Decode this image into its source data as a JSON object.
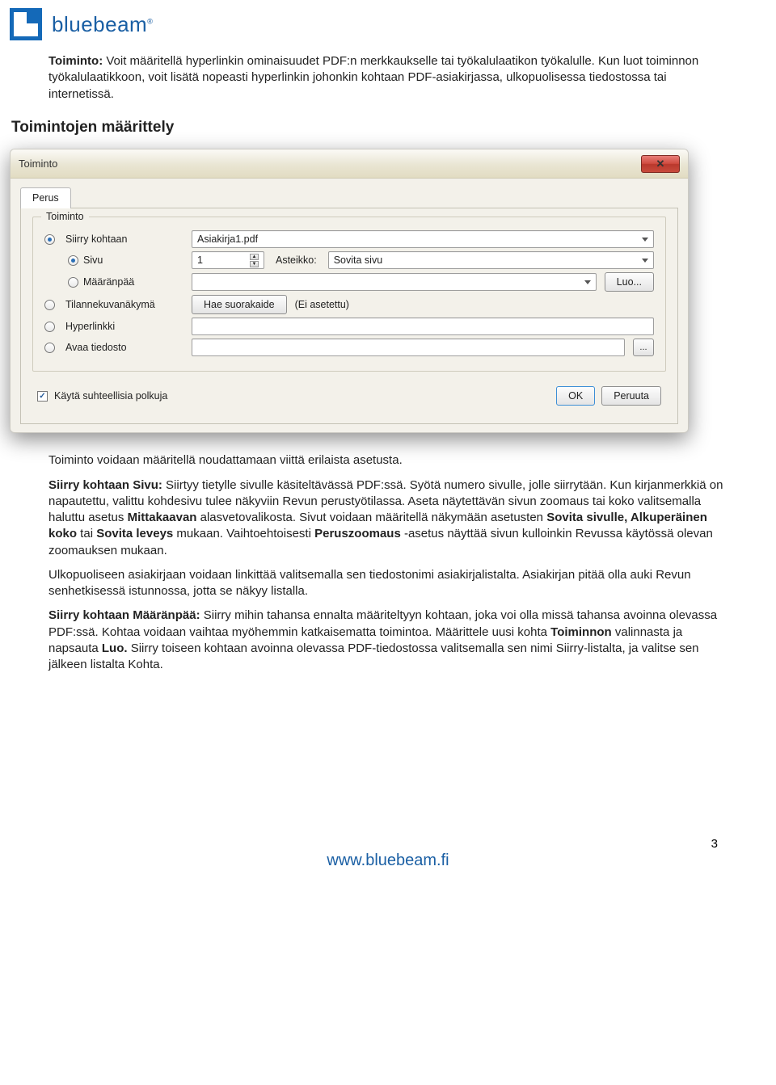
{
  "header": {
    "brand": "bluebeam"
  },
  "intro": {
    "label": "Toiminto:",
    "text": " Voit määritellä hyperlinkin ominaisuudet PDF:n merkkaukselle tai työkalulaatikon työkalulle. Kun luot toiminnon työkalulaatikkoon, voit lisätä nopeasti hyperlinkin johonkin kohtaan PDF-asiakirjassa, ulkopuolisessa tiedostossa tai internetissä."
  },
  "section_heading": "Toimintojen määrittely",
  "dialog": {
    "title": "Toiminto",
    "tab": "Perus",
    "group": "Toiminto",
    "r_siirry": "Siirry kohtaan",
    "r_sivu": "Sivu",
    "r_maaranpaa": "Määränpää",
    "r_tilanne": "Tilannekuvanäkymä",
    "r_hyperlinkki": "Hyperlinkki",
    "r_avaa": "Avaa tiedosto",
    "combo_doc": "Asiakirja1.pdf",
    "page_value": "1",
    "asteikko_label": "Asteikko:",
    "asteikko_value": "Sovita sivu",
    "btn_luo": "Luo...",
    "btn_hae": "Hae suorakaide",
    "ei_asetettu": "(Ei asetettu)",
    "browse": "...",
    "chk_label": "Käytä suhteellisia polkuja",
    "ok": "OK",
    "cancel": "Peruuta"
  },
  "body": {
    "p1": "Toiminto voidaan määritellä noudattamaan viittä erilaista asetusta.",
    "p2a_bold": "Siirry kohtaan Sivu:",
    "p2a": " Siirtyy tietylle sivulle käsiteltävässä PDF:ssä. Syötä numero sivulle, jolle siirrytään. Kun kirjanmerkkiä on napautettu, valittu kohdesivu tulee näkyviin Revun perustyötilassa. Aseta näytettävän sivun zoomaus tai koko valitsemalla haluttu asetus ",
    "p2b_bold": "Mittakaavan",
    "p2b": " alasvetovalikosta. Sivut voidaan määritellä näkymään asetusten ",
    "p2c_bold": "Sovita sivulle, Alkuperäinen koko",
    "p2c": " tai ",
    "p2d_bold": "Sovita leveys",
    "p2d": " mukaan. Vaihtoehtoisesti ",
    "p2e_bold": "Peruszoomaus",
    "p2e": " -asetus näyttää sivun kulloinkin Revussa käytössä olevan zoomauksen mukaan.",
    "p3": "Ulkopuoliseen asiakirjaan voidaan linkittää valitsemalla sen tiedostonimi asiakirjalistalta. Asiakirjan pitää olla auki Revun senhetkisessä istunnossa, jotta se näkyy listalla.",
    "p4a_bold": "Siirry kohtaan Määränpää:",
    "p4a": " Siirry mihin tahansa ennalta määriteltyyn kohtaan, joka voi olla missä tahansa avoinna olevassa PDF:ssä. Kohtaa voidaan vaihtaa myöhemmin katkaisematta toimintoa. Määrittele uusi kohta ",
    "p4b_bold": "Toiminnon",
    "p4b": " valinnasta ja napsauta ",
    "p4c_bold": "Luo.",
    "p4c": " Siirry toiseen kohtaan avoinna olevassa PDF-tiedostossa valitsemalla sen nimi Siirry-listalta, ja valitse sen jälkeen listalta Kohta."
  },
  "footer": {
    "url": "www.bluebeam.fi",
    "page": "3"
  }
}
